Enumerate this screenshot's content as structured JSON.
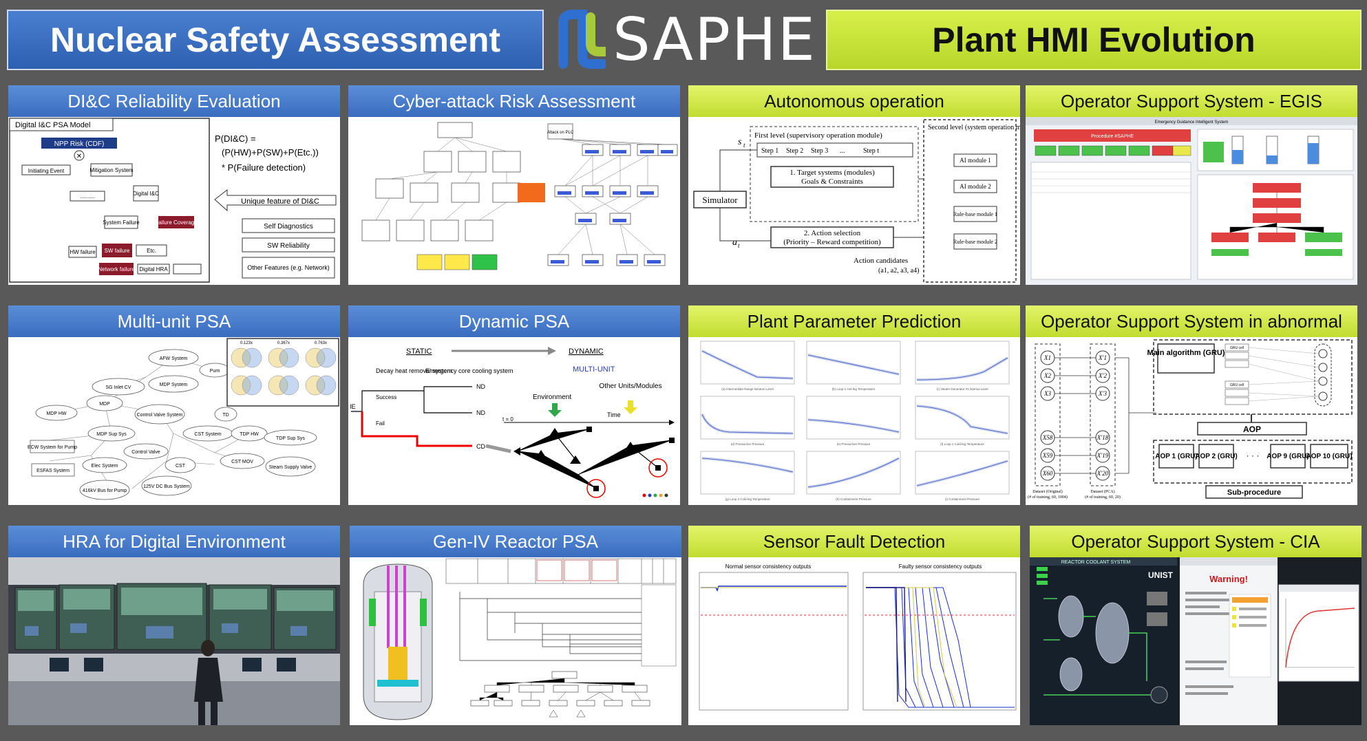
{
  "header": {
    "left_banner": "Nuclear Safety Assessment",
    "logo_text": "SAPHE",
    "right_banner": "Plant HMI Evolution"
  },
  "colors": {
    "blue_banner": "#2d5fb0",
    "green_banner": "#c2dc30",
    "background": "#595959"
  },
  "panels": {
    "dic": {
      "title": "DI&C Reliability Evaluation",
      "model_label": "Digital I&C PSA Model",
      "npp": "NPP Risk (CDF)",
      "ie": "Initiating Event",
      "mit": "Mitigation System",
      "digital": "Digital I&C",
      "sys_fail": "System Failure",
      "fail_cov": "Failure Coverage",
      "hw": "HW failure",
      "sw": "SW failure",
      "etc": "Etc.",
      "net": "Network failure",
      "dhra": "Digital HRA",
      "formula1": "P(DI&C) =",
      "formula2": "(P(HW)+P(SW)+P(Etc.))",
      "formula3": "* P(Failure detection)",
      "unique": "Unique feature of DI&C",
      "f1": "Self Diagnostics",
      "f2": "SW Reliability",
      "f3": "Other Features (e.g. Network)"
    },
    "cyber": {
      "title": "Cyber-attack Risk Assessment",
      "top_event": "Attack on PLC"
    },
    "auto": {
      "title": "Autonomous operation",
      "first": "First level (supervisory operation module)",
      "step1": "Step 1",
      "step2": "Step 2",
      "step3": "Step 3",
      "stept": "Step t",
      "target1": "1.  Target systems (modules)",
      "target2": "Goals & Constraints",
      "sim": "Simulator",
      "act1": "2. Action selection",
      "act2": "(Priority – Reward competition)",
      "cand": "Action candidates",
      "cand2": "(a1, a2, a3, a4)",
      "second": "Second level (system operation module)",
      "m1": "AI module 1",
      "m2": "AI module 2",
      "m3": "Rule-base module 1",
      "m4": "Rule-base module 2"
    },
    "egis": {
      "title": "Operator Support System - EGIS",
      "sys_title": "Emergency Guidance Intelligent System",
      "proc": "Procedure #SAPHE"
    },
    "multi": {
      "title": "Multi-unit PSA",
      "n1": "AFW System",
      "n2": "SG Inlet CV",
      "n3": "MDP System",
      "n4": "MDP",
      "n5": "MDP HW",
      "n6": "Control Valve System",
      "n7": "MDP Sup Sys",
      "n8": "CST System",
      "n9": "TDP HW",
      "n10": "ECW System for Pump",
      "n11": "Control Valve",
      "n12": "TDP Sup Sys",
      "n13": "ESFAS System",
      "n14": "Elec System",
      "n15": "CST",
      "n16": "CST MOV",
      "n17": "Steam Supply Valve",
      "n18": "416kV Bus for Pump",
      "n19": "125V DC Bus System",
      "p1": "Pum",
      "p2": "TD",
      "v1": "0.123x",
      "v2": "0.367x",
      "v3": "0.763x"
    },
    "dyn": {
      "title": "Dynamic PSA",
      "static": "STATIC",
      "dynamic": "DYNAMIC",
      "multi": "MULTI-UNIT",
      "decay": "Decay heat removal system",
      "ecc": "Emergency core cooling system",
      "ie": "IE",
      "success": "Success",
      "fail": "Fail",
      "nd1": "ND",
      "nd2": "ND",
      "cd": "CD",
      "env": "Environment",
      "other": "Other Units/Modules",
      "time": "Time",
      "t0": "t = 0"
    },
    "ppp": {
      "title": "Plant Parameter Prediction",
      "c1": "(a) Intermediate Range Neutron Level",
      "c2": "(b) Loop 1 Hot-leg Temperature",
      "c3": "(c) Steam Generator #1 Narrow Level",
      "c4": "(d) Pressurizer Pressure",
      "c5": "(e) Pressurizer Pressure",
      "c6": "(f) Loop 1 Cold-leg Temperature",
      "c7": "(g) Loop 2 Cold-leg Temperature",
      "c8": "(h) Containment Pressure",
      "c9": "(i) Containment Pressure"
    },
    "abn": {
      "title": "Operator Support System in abnormal",
      "main": "Main algorithm (GRU)",
      "aop": "AOP",
      "a1": "AOP 1 (GRU)",
      "a2": "AOP 2 (GRU)",
      "a9": "AOP 9 (GRU)",
      "a10": "AOP 10 (GRU)",
      "sub": "Sub-procedure",
      "d1": "Dataset (Original)",
      "d1n": "(# of training, 60, 1004)",
      "d2": "Dataset (PCA)",
      "d2n": "(# of training, 60, 20)",
      "gru": "GRU cell",
      "x1": "X1",
      "x2": "X2",
      "x3": "X3",
      "x58": "X58",
      "x59": "X59",
      "x60": "X60",
      "y1": "X'1",
      "y2": "X'2",
      "y3": "X'3",
      "y18": "X'18",
      "y19": "X'19",
      "y20": "X'20"
    },
    "hra": {
      "title": "HRA for Digital Environment"
    },
    "gen": {
      "title": "Gen-IV Reactor PSA"
    },
    "sensor": {
      "title": "Sensor Fault Detection",
      "normal": "Normal sensor consistency outputs",
      "faulty": "Faulty sensor consistency outputs"
    },
    "cia": {
      "title": "Operator Support System - CIA",
      "rcs": "REACTOR COOLANT SYSTEM",
      "warning": "Warning!",
      "unist": "UNIST"
    }
  }
}
